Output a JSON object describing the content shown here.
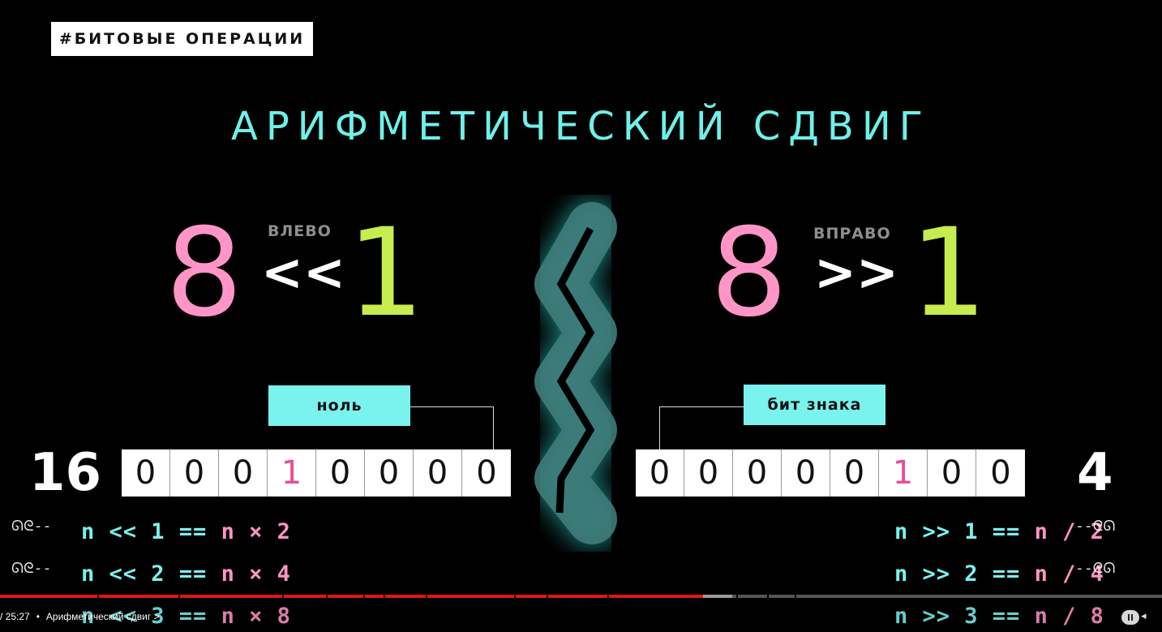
{
  "slide": {
    "tag": "#БИТОВЫЕ ОПЕРАЦИИ",
    "title": "АРИФМЕТИЧЕСКИЙ СДВИГ",
    "left": {
      "operand": "8",
      "operator": "<<",
      "shift": "1",
      "direction_label": "ВЛЕВО",
      "callout": "ноль",
      "bits": [
        "0",
        "0",
        "0",
        "1",
        "0",
        "0",
        "0",
        "0"
      ],
      "highlight_index": 3,
      "result": "16",
      "formulas": [
        {
          "pre": "n << 1 == ",
          "post": "n × 2"
        },
        {
          "pre": "n << 2 == ",
          "post": "n × 4"
        },
        {
          "pre": "n << 3 == ",
          "post": "n × 8"
        }
      ]
    },
    "right": {
      "operand": "8",
      "operator": ">>",
      "shift": "1",
      "direction_label": "ВПРАВО",
      "callout": "бит знака",
      "bits": [
        "0",
        "0",
        "0",
        "0",
        "0",
        "1",
        "0",
        "0"
      ],
      "highlight_index": 5,
      "result": "4",
      "formulas": [
        {
          "pre": "n >> 1 == ",
          "post": "n / 2"
        },
        {
          "pre": "n >> 2 == ",
          "post": "n / 4"
        },
        {
          "pre": "n >> 3 == ",
          "post": "n / 8"
        }
      ]
    },
    "divider": "zigzag-divider"
  },
  "player": {
    "time": "/ 25:27",
    "separator": "•",
    "chapter": "Арифметический сдвиг",
    "chapter_chevron": ">",
    "progress_played": 0.605,
    "progress_buffered": 0.63,
    "colors": {
      "played": "#e0151b",
      "buffer": "#9c9c9c",
      "track": "#555555"
    }
  },
  "colors": {
    "accent_cyan": "#7af2ee",
    "pink": "#ff94c6",
    "lime": "#c6ec4f",
    "bit_highlight": "#e84d95"
  }
}
